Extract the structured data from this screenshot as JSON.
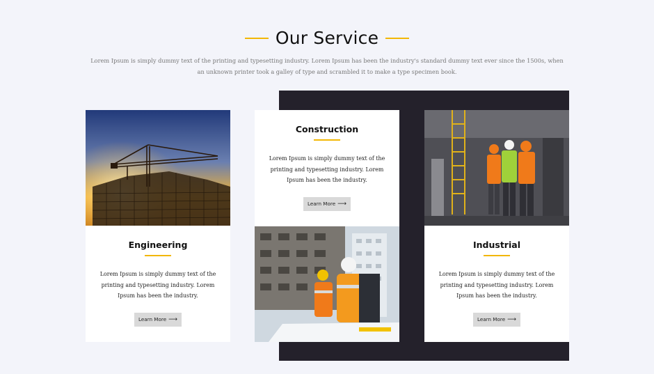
{
  "section": {
    "title": "Our Service",
    "intro": "Lorem Ipsum is simply dummy text of the printing and typesetting industry. Lorem Ipsum has been the industry's standard dummy text ever since the 1500s, when an unknown printer took a galley of type and scrambled it to make a type specimen book."
  },
  "cards": [
    {
      "title": "Engineering",
      "text": "Lorem Ipsum is simply dummy text of the printing and typesetting industry. Lorem Ipsum has been the industry.",
      "button": "Learn More",
      "arrow": "⟶"
    },
    {
      "title": "Construction",
      "text": "Lorem Ipsum is simply dummy text of the printing and typesetting industry. Lorem Ipsum has been the industry.",
      "button": "Learn More",
      "arrow": "⟶"
    },
    {
      "title": "Industrial",
      "text": "Lorem Ipsum is simply dummy text of the printing and typesetting industry. Lorem Ipsum has been the industry.",
      "button": "Learn More",
      "arrow": "⟶"
    }
  ],
  "colors": {
    "accent": "#f2b705",
    "dark_panel": "#24212b",
    "page_bg": "#f3f4fa",
    "button_bg": "#d9d9d9"
  }
}
